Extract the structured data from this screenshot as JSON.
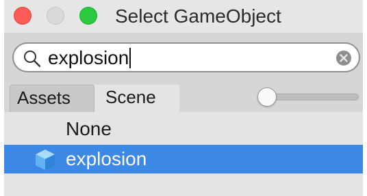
{
  "window": {
    "title": "Select GameObject"
  },
  "search": {
    "value": "explosion"
  },
  "tabs": [
    {
      "label": "Assets"
    },
    {
      "label": "Scene"
    }
  ],
  "zoom_slider": {
    "level": 0.0
  },
  "list": {
    "items": [
      {
        "label": "None",
        "selected": false,
        "icon": null
      },
      {
        "label": "explosion",
        "selected": true,
        "icon": "cube-icon"
      }
    ]
  },
  "colors": {
    "selection": "#3c88e5",
    "close": "#fc5b57",
    "maximize": "#2ac940"
  }
}
